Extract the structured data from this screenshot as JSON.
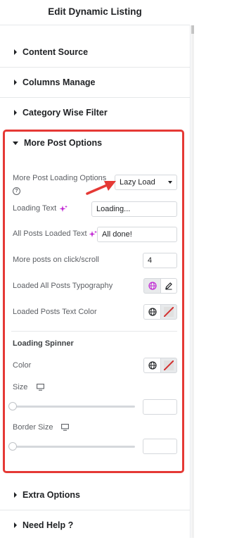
{
  "header": {
    "title": "Edit Dynamic Listing"
  },
  "sections": {
    "content_source": "Content Source",
    "columns_manage": "Columns Manage",
    "category_wise_filter": "Category Wise Filter",
    "more_post_options": "More Post Options",
    "extra_options": "Extra Options",
    "need_help": "Need Help ?"
  },
  "more_post": {
    "loading_options_label": "More Post Loading Options",
    "loading_options_help": "?",
    "loading_options_value": "Lazy Load",
    "loading_text_label": "Loading Text",
    "loading_text_value": "Loading...",
    "all_loaded_label": "All Posts Loaded Text",
    "all_loaded_value": "All done!",
    "more_posts_label": "More posts on click/scroll",
    "more_posts_value": "4",
    "typography_label": "Loaded All Posts Typography",
    "text_color_label": "Loaded Posts Text Color"
  },
  "spinner": {
    "heading": "Loading Spinner",
    "color_label": "Color",
    "size_label": "Size",
    "size_value": "",
    "border_size_label": "Border Size",
    "border_size_value": ""
  },
  "colors": {
    "highlight_border": "#e53935",
    "arrow": "#e53935",
    "ai_icon": "#c026d3",
    "globe_active": "#c026d3"
  },
  "icons": [
    "caret-right-icon",
    "caret-down-icon",
    "help-icon",
    "ai-sparkle-icon",
    "globe-icon",
    "pencil-icon",
    "desktop-icon",
    "no-color-icon"
  ]
}
